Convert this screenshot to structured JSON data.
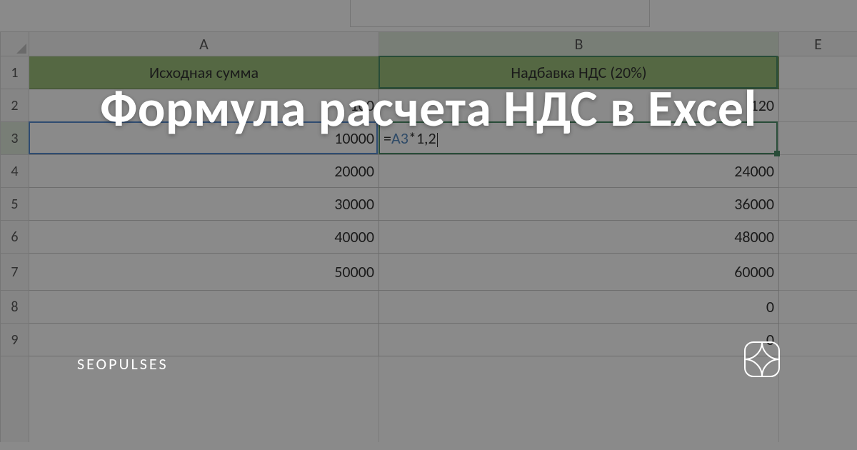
{
  "overlay": {
    "title": "Формула расчета НДС в Excel",
    "brand": "SEOPULSES"
  },
  "columns": {
    "A": "A",
    "B": "B",
    "E": "E"
  },
  "header_row": {
    "A": "Исходная сумма",
    "B": "Надбавка НДС (20%)"
  },
  "rows": [
    {
      "n": "1"
    },
    {
      "n": "2",
      "A": "100",
      "B": "120"
    },
    {
      "n": "3",
      "A": "10000",
      "B_formula_ref": "A3",
      "B_formula_tail": "*1,2"
    },
    {
      "n": "4",
      "A": "20000",
      "B": "24000"
    },
    {
      "n": "5",
      "A": "30000",
      "B": "36000"
    },
    {
      "n": "6",
      "A": "40000",
      "B": "48000"
    },
    {
      "n": "7",
      "A": "50000",
      "B": "60000"
    },
    {
      "n": "8",
      "A": "",
      "B": "0"
    },
    {
      "n": "9",
      "A": "",
      "B": "0"
    }
  ],
  "active": {
    "cell": "B3",
    "col": "B",
    "row": "3"
  }
}
